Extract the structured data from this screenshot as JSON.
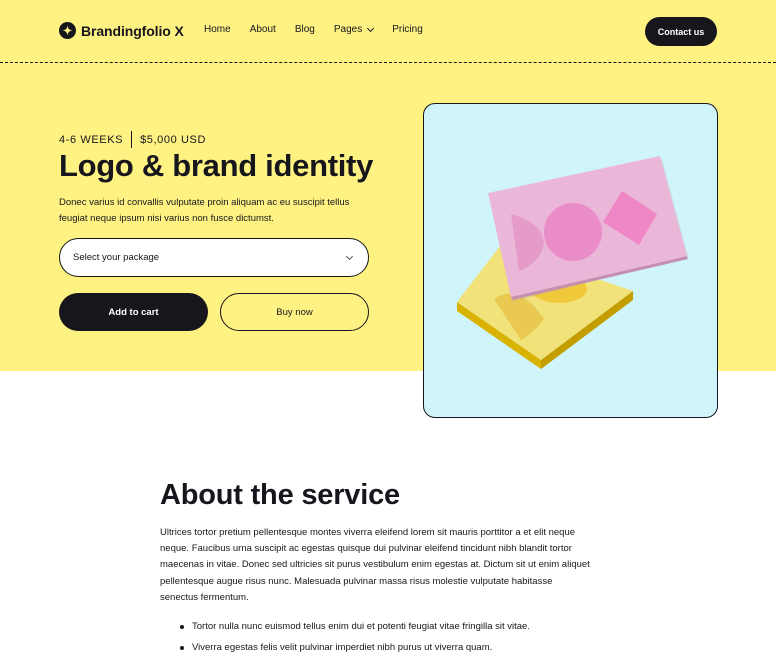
{
  "brand": {
    "name": "Brandingfolio X",
    "logo_icon": "sparkle-icon"
  },
  "nav": {
    "items": [
      {
        "label": "Home"
      },
      {
        "label": "About"
      },
      {
        "label": "Blog"
      },
      {
        "label": "Pages",
        "dropdown": true
      },
      {
        "label": "Pricing"
      }
    ],
    "contact_label": "Contact us"
  },
  "product": {
    "duration": "4-6 WEEKS",
    "price": "$5,000 USD",
    "title": "Logo & brand identity",
    "description": "Donec varius id convallis vulputate proin aliquam ac eu suscipit tellus feugiat neque ipsum nisi varius non fusce dictumst.",
    "package_select": {
      "value": "Select your package"
    },
    "add_to_cart_label": "Add to cart",
    "buy_now_label": "Buy now"
  },
  "about": {
    "title": "About the service",
    "body": "Ultrices tortor pretium pellentesque montes viverra eleifend lorem sit mauris porttitor a et elit neque neque. Faucibus urna suscipit ac egestas quisque dui pulvinar eleifend tincidunt nibh blandit tortor maecenas in vitae. Donec sed ultricies sit purus vestibulum enim egestas at. Dictum sit ut enim aliquet pellentesque augue risus nunc. Malesuada pulvinar massa risus molestie vulputate habitasse senectus fermentum.",
    "bullets": [
      "Tortor nulla nunc euismod tellus enim dui et potenti feugiat vitae fringilla sit vitae.",
      "Viverra egestas felis velit pulvinar imperdiet nibh purus ut viverra quam."
    ]
  },
  "colors": {
    "hero_background": "#fef283",
    "image_background": "#cff4f9",
    "dark": "#17161c",
    "card_pink": "#eab7d8",
    "card_yellow": "#f1e27a"
  }
}
